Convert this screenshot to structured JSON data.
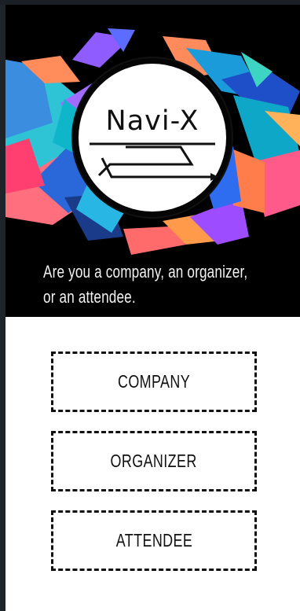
{
  "hero": {
    "logo_text": "Navi-X",
    "prompt_line_1": "Are you a company, an organizer,",
    "prompt_line_2": "or an attendee."
  },
  "choices": [
    {
      "label": "COMPANY"
    },
    {
      "label": "ORGANIZER"
    },
    {
      "label": "ATTENDEE"
    }
  ],
  "colors": {
    "background": "#000000",
    "panel": "#ffffff",
    "frame": "#1b1f26",
    "text_light": "#f2f2f2",
    "text_dark": "#111111"
  },
  "icons": [
    "logo-arrow-icon"
  ]
}
